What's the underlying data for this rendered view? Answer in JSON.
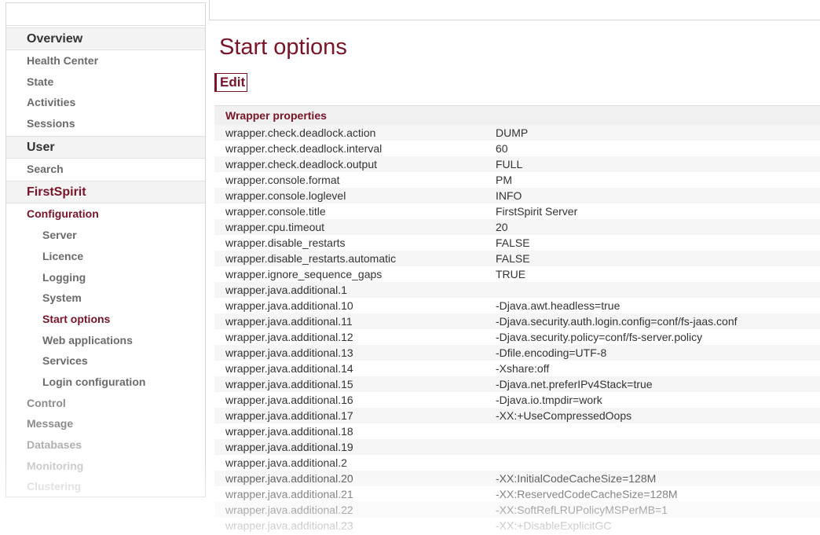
{
  "sidebar": {
    "overview_section": "Overview",
    "overview_items": [
      "Health Center",
      "State",
      "Activities",
      "Sessions"
    ],
    "user_section": "User",
    "user_items": [
      "Search"
    ],
    "firstspirit_section": "FirstSpirit",
    "configuration": "Configuration",
    "config_items": [
      "Server",
      "Licence",
      "Logging",
      "System",
      "Start options",
      "Web applications",
      "Services",
      "Login configuration"
    ],
    "bottom_items": [
      "Control",
      "Message",
      "Databases",
      "Monitoring",
      "Clustering"
    ]
  },
  "page": {
    "title": "Start options",
    "edit_label": "Edit"
  },
  "table": {
    "header": "Wrapper properties",
    "rows": [
      [
        "wrapper.check.deadlock.action",
        "DUMP"
      ],
      [
        "wrapper.check.deadlock.interval",
        "60"
      ],
      [
        "wrapper.check.deadlock.output",
        "FULL"
      ],
      [
        "wrapper.console.format",
        "PM"
      ],
      [
        "wrapper.console.loglevel",
        "INFO"
      ],
      [
        "wrapper.console.title",
        "FirstSpirit Server"
      ],
      [
        "wrapper.cpu.timeout",
        "20"
      ],
      [
        "wrapper.disable_restarts",
        "FALSE"
      ],
      [
        "wrapper.disable_restarts.automatic",
        "FALSE"
      ],
      [
        "wrapper.ignore_sequence_gaps",
        "TRUE"
      ],
      [
        "wrapper.java.additional.1",
        ""
      ],
      [
        "wrapper.java.additional.10",
        "-Djava.awt.headless=true"
      ],
      [
        "wrapper.java.additional.11",
        "-Djava.security.auth.login.config=conf/fs-jaas.conf"
      ],
      [
        "wrapper.java.additional.12",
        "-Djava.security.policy=conf/fs-server.policy"
      ],
      [
        "wrapper.java.additional.13",
        "-Dfile.encoding=UTF-8"
      ],
      [
        "wrapper.java.additional.14",
        "-Xshare:off"
      ],
      [
        "wrapper.java.additional.15",
        "-Djava.net.preferIPv4Stack=true"
      ],
      [
        "wrapper.java.additional.16",
        "-Djava.io.tmpdir=work"
      ],
      [
        "wrapper.java.additional.17",
        "-XX:+UseCompressedOops"
      ],
      [
        "wrapper.java.additional.18",
        ""
      ],
      [
        "wrapper.java.additional.19",
        ""
      ],
      [
        "wrapper.java.additional.2",
        ""
      ],
      [
        "wrapper.java.additional.20",
        "-XX:InitialCodeCacheSize=128M"
      ],
      [
        "wrapper.java.additional.21",
        "-XX:ReservedCodeCacheSize=128M"
      ],
      [
        "wrapper.java.additional.22",
        "-XX:SoftRefLRUPolicyMSPerMB=1"
      ],
      [
        "wrapper.java.additional.23",
        "-XX:+DisableExplicitGC"
      ]
    ]
  }
}
